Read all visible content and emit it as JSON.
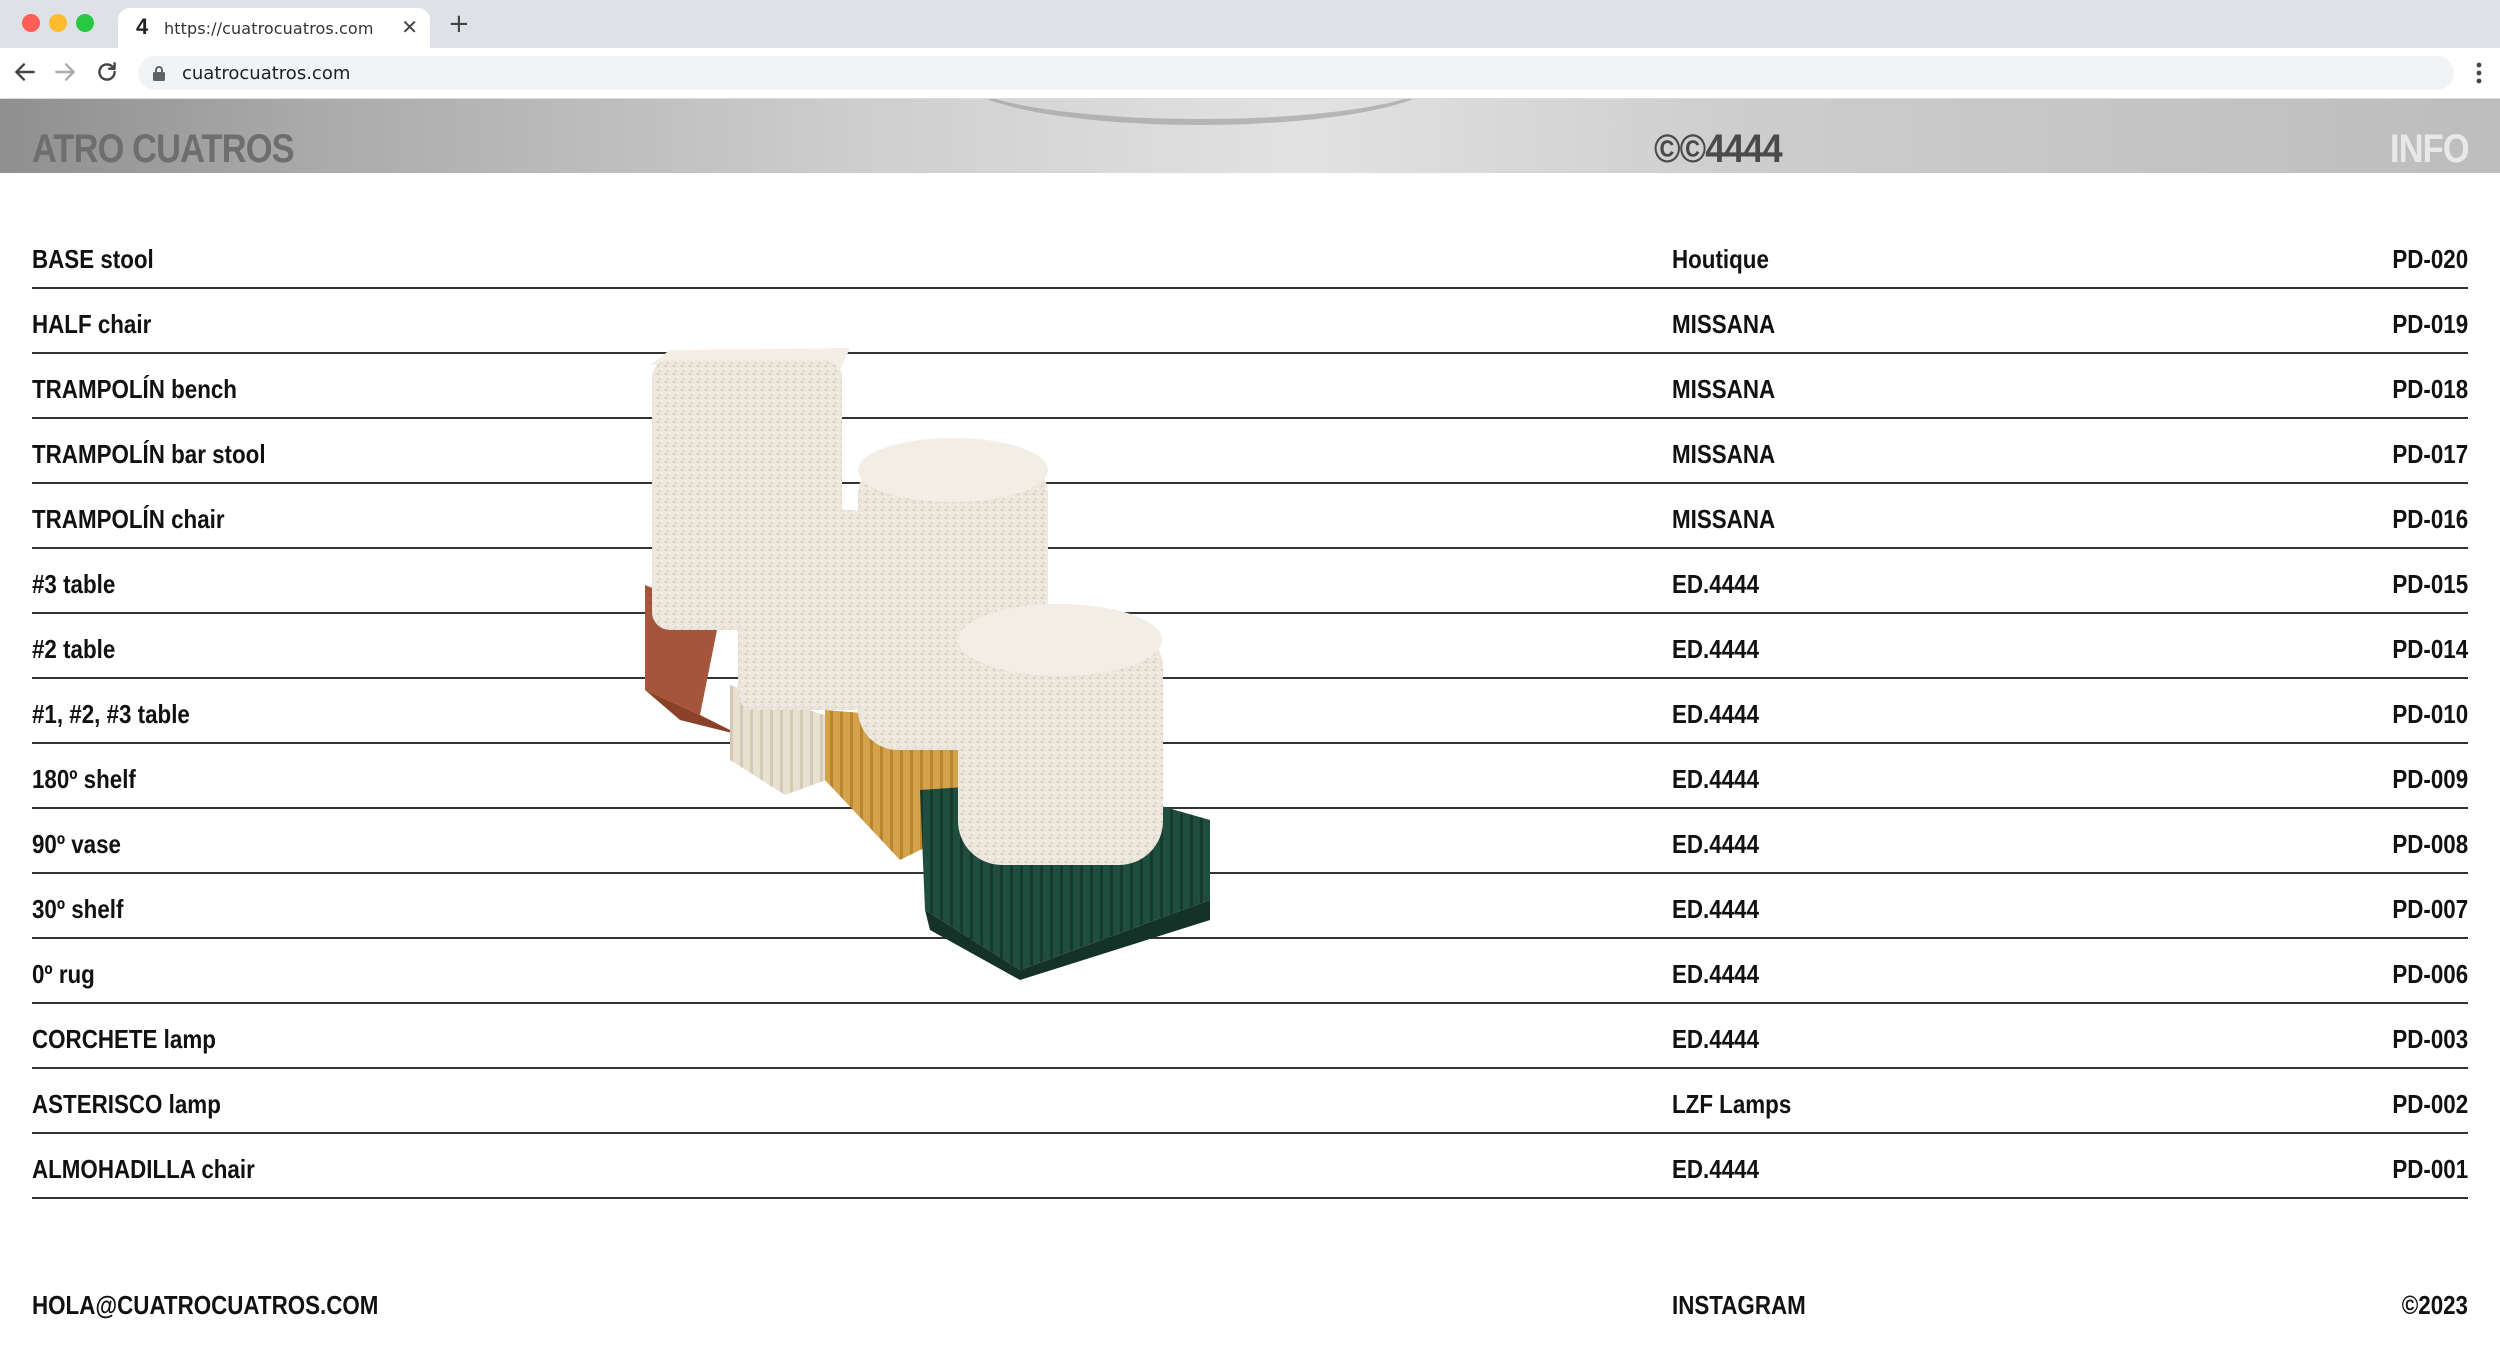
{
  "browser": {
    "tab_favicon": "4",
    "tab_title": "https://cuatrocuatros.com",
    "tab_close": "✕",
    "new_tab": "+",
    "address": "cuatrocuatros.com"
  },
  "header": {
    "brand": "ATRO CUATROS",
    "mark": "©©4444",
    "info": "INFO"
  },
  "products": [
    {
      "name": "BASE stool",
      "maker": "Houtique",
      "code": "PD-020"
    },
    {
      "name": "HALF chair",
      "maker": "MISSANA",
      "code": "PD-019"
    },
    {
      "name": "TRAMPOLÍN bench",
      "maker": "MISSANA",
      "code": "PD-018"
    },
    {
      "name": "TRAMPOLÍN bar stool",
      "maker": "MISSANA",
      "code": "PD-017"
    },
    {
      "name": "TRAMPOLÍN chair",
      "maker": "MISSANA",
      "code": "PD-016"
    },
    {
      "name": "#3 table",
      "maker": "ED.4444",
      "code": "PD-015"
    },
    {
      "name": "#2 table",
      "maker": "ED.4444",
      "code": "PD-014"
    },
    {
      "name": "#1, #2, #3 table",
      "maker": "ED.4444",
      "code": "PD-010"
    },
    {
      "name": "180º shelf",
      "maker": "ED.4444",
      "code": "PD-009"
    },
    {
      "name": "90º vase",
      "maker": "ED.4444",
      "code": "PD-008"
    },
    {
      "name": "30º shelf",
      "maker": "ED.4444",
      "code": "PD-007"
    },
    {
      "name": "0º rug",
      "maker": "ED.4444",
      "code": "PD-006"
    },
    {
      "name": "CORCHETE lamp",
      "maker": "ED.4444",
      "code": "PD-003"
    },
    {
      "name": "ASTERISCO lamp",
      "maker": "LZF Lamps",
      "code": "PD-002"
    },
    {
      "name": "ALMOHADILLA chair",
      "maker": "ED.4444",
      "code": "PD-001"
    }
  ],
  "footer": {
    "email": "HOLA@CUATROCUATROS.COM",
    "instagram": "INSTAGRAM",
    "copyright": "©2023"
  },
  "colors": {
    "upholstery": "#ece6dc",
    "red_marble": "#a4553a",
    "cream_base": "#e8e0d0",
    "yellow_base": "#d4a24a",
    "green_base": "#1f4d3e"
  },
  "icons": [
    "back-arrow-icon",
    "forward-arrow-icon",
    "reload-icon",
    "lock-icon",
    "menu-dots-icon",
    "close-icon",
    "plus-icon"
  ]
}
